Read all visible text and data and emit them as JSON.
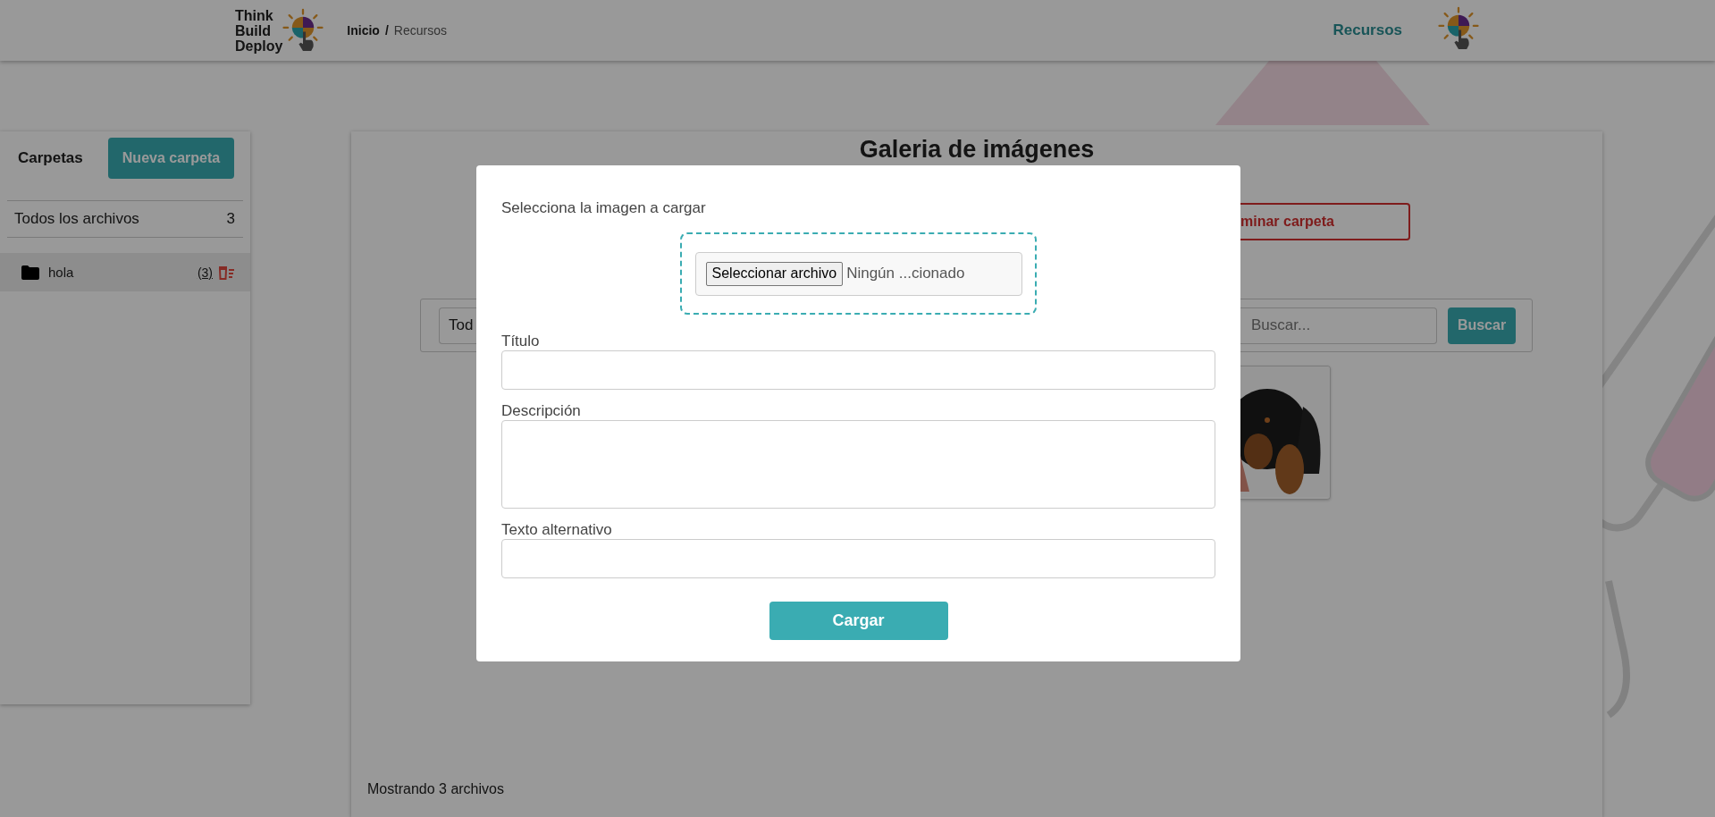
{
  "header": {
    "logo_lines": [
      "Think",
      "Build",
      "Deploy"
    ],
    "breadcrumb": {
      "separator": "/",
      "items": [
        {
          "label": "Inicio",
          "current": false
        },
        {
          "label": "Recursos",
          "current": true
        }
      ]
    },
    "nav": [
      {
        "label": "Recursos",
        "selected": true
      }
    ]
  },
  "sidebar": {
    "title": "Carpetas",
    "new_button": "Nueva carpeta",
    "all_files": {
      "label": "Todos los archivos",
      "count": "3"
    },
    "folders": [
      {
        "name": "hola",
        "count": "(3)",
        "selected": true
      }
    ]
  },
  "gallery": {
    "title": "Galeria de imágenes",
    "delete_button": "minar carpeta",
    "filter": "Tod",
    "search": {
      "placeholder": "Buscar..."
    },
    "search_button": "Buscar",
    "footer": "Mostrando 3 archivos"
  },
  "modal": {
    "prompt": "Selecciona la imagen a cargar",
    "file_button": "Seleccionar archivo",
    "file_status": "Ningún ...cionado",
    "fields": [
      {
        "label": "Título",
        "kind": "input"
      },
      {
        "label": "Descripción",
        "kind": "textarea"
      },
      {
        "label": "Texto alternativo",
        "kind": "input"
      }
    ],
    "submit": "Cargar"
  }
}
